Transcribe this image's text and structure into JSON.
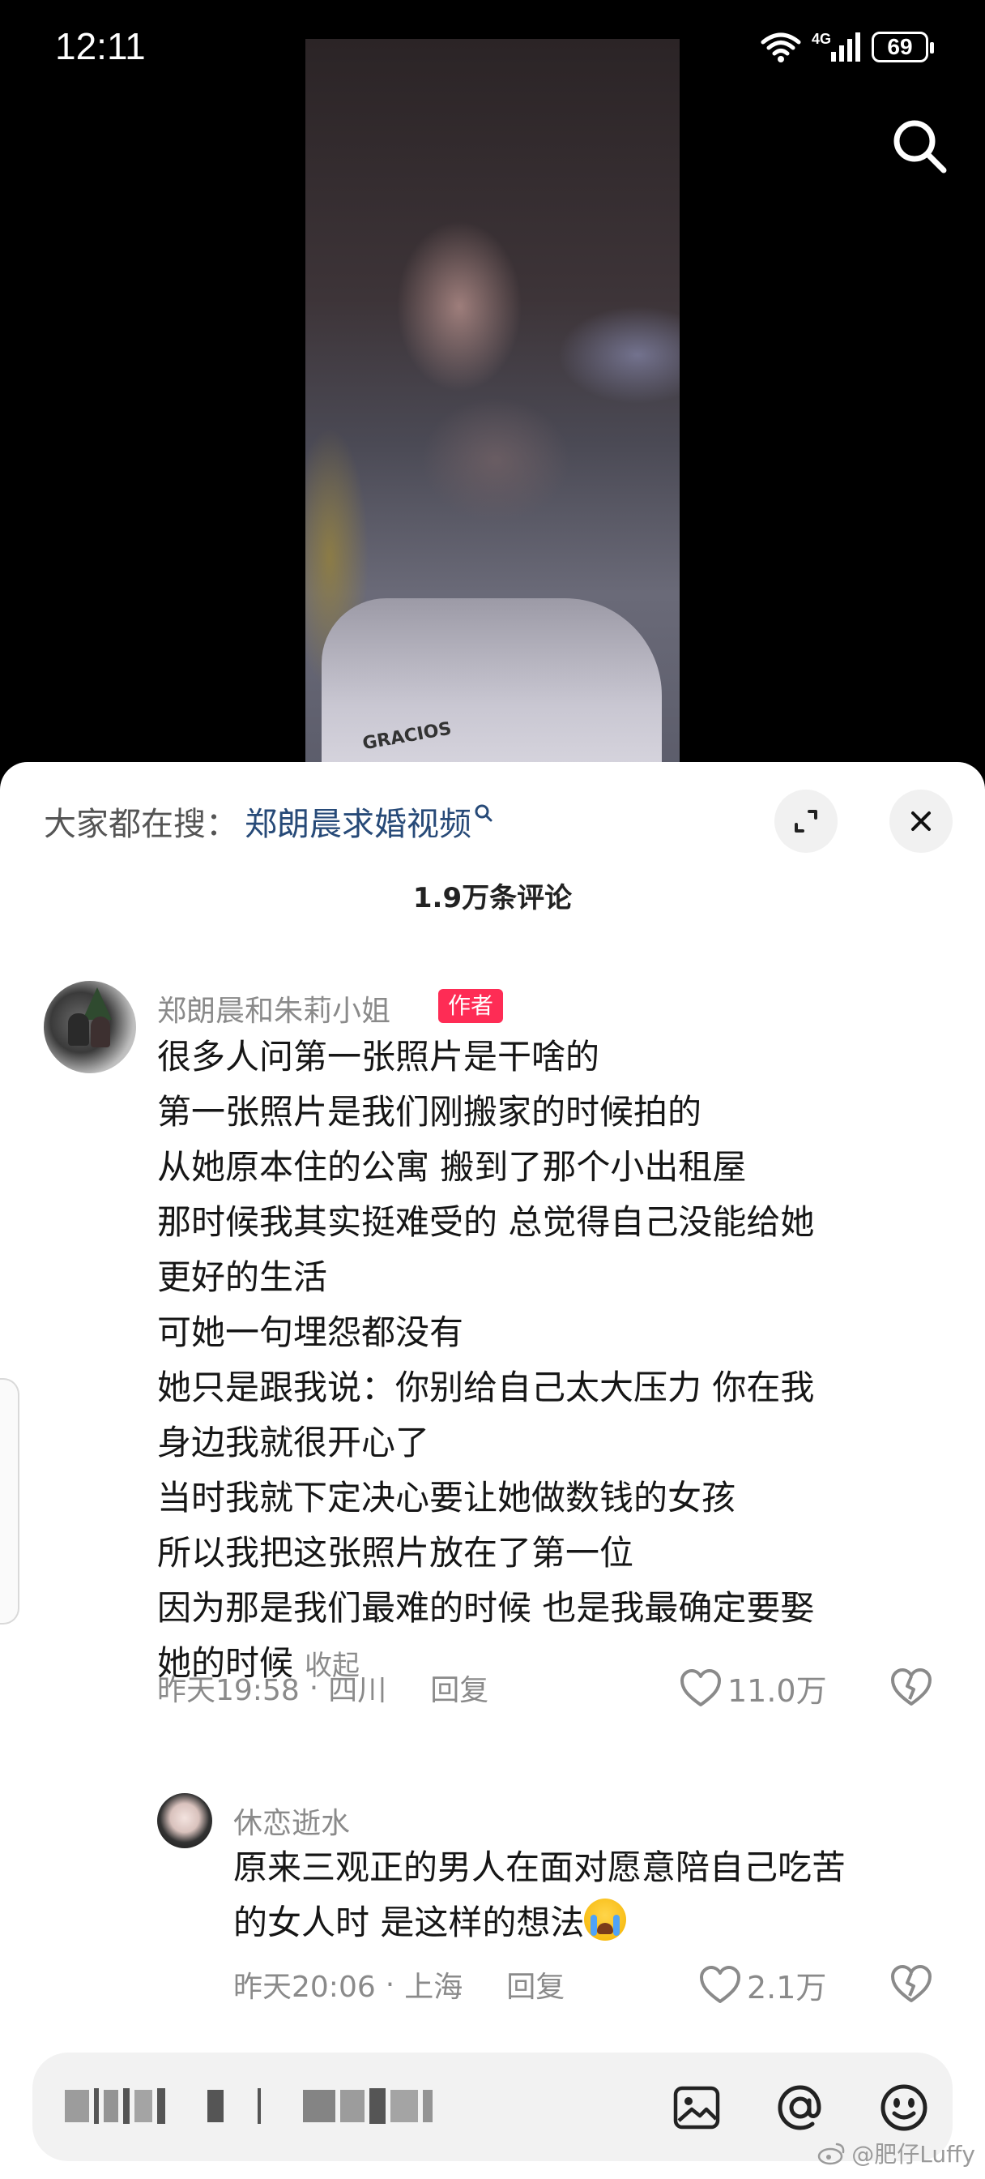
{
  "status_bar": {
    "time": "12:11",
    "network": "4G",
    "battery": "69"
  },
  "video": {
    "shirt_text": "GRACIOS"
  },
  "sheet": {
    "search_prefix": "大家都在搜：",
    "search_term": "郑朗晨求婚视频",
    "comment_count": "1.9万条评论"
  },
  "comments": [
    {
      "username": "郑朗晨和朱莉小姐",
      "badge": "作者",
      "lines": [
        "很多人问第一张照片是干啥的",
        "第一张照片是我们刚搬家的时候拍的",
        "从她原本住的公寓 搬到了那个小出租屋",
        "那时候我其实挺难受的 总觉得自己没能给她",
        "更好的生活",
        "可她一句埋怨都没有",
        "她只是跟我说：你别给自己太大压力 你在我",
        "身边我就很开心了",
        "当时我就下定决心要让她做数钱的女孩",
        "所以我把这张照片放在了第一位",
        "因为那是我们最难的时候 也是我最确定要娶",
        "她的时候"
      ],
      "collapse": "收起",
      "time": "昨天19:58",
      "location": "四川",
      "reply": "回复",
      "likes": "11.0万",
      "replies": [
        {
          "username": "休恋逝水",
          "lines": [
            "原来三观正的男人在面对愿意陪自己吃苦",
            "的女人时 是这样的想法"
          ],
          "time": "昨天20:06",
          "location": "上海",
          "reply": "回复",
          "likes": "2.1万"
        }
      ]
    }
  ],
  "watermark": "@肥仔Luffy",
  "colors": {
    "accent_link": "#274a78",
    "author_badge": "#fe2c55",
    "muted_text": "#8a8a8a"
  }
}
